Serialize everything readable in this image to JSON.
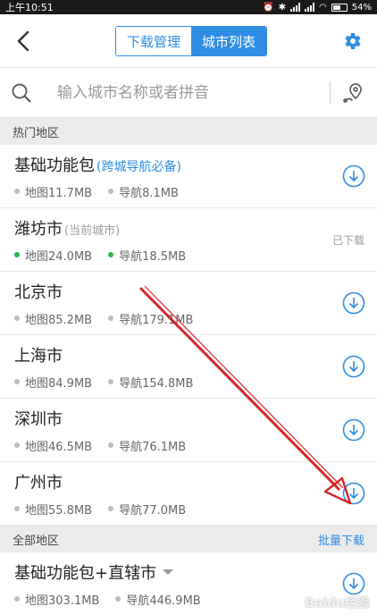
{
  "status_bar": {
    "time": "上午10:51",
    "battery": "54%"
  },
  "header": {
    "tabs": [
      "下载管理",
      "城市列表"
    ],
    "active_tab": 1
  },
  "search": {
    "placeholder": "输入城市名称或者拼音"
  },
  "hot_section": {
    "title": "热门地区"
  },
  "hot_cities": [
    {
      "name": "基础功能包",
      "note": "(跨城导航必备)",
      "map": "地图11.7MB",
      "nav": "导航8.1MB",
      "state": "download"
    },
    {
      "name": "潍坊市",
      "note": "(当前城市)",
      "map": "地图24.0MB",
      "nav": "导航18.5MB",
      "state": "downloaded",
      "state_label": "已下载"
    },
    {
      "name": "北京市",
      "note": "",
      "map": "地图85.2MB",
      "nav": "导航179.1MB",
      "state": "download"
    },
    {
      "name": "上海市",
      "note": "",
      "map": "地图84.9MB",
      "nav": "导航154.8MB",
      "state": "download"
    },
    {
      "name": "深圳市",
      "note": "",
      "map": "地图46.5MB",
      "nav": "导航76.1MB",
      "state": "download"
    },
    {
      "name": "广州市",
      "note": "",
      "map": "地图55.8MB",
      "nav": "导航77.0MB",
      "state": "download"
    }
  ],
  "all_section": {
    "title": "全部地区",
    "action": "批量下载"
  },
  "all_cities": [
    {
      "name": "基础功能包+直辖市",
      "map": "地图303.1MB",
      "nav": "导航446.9MB",
      "state": "download"
    }
  ],
  "watermark": "Baidu经验",
  "colors": {
    "accent": "#2f8de4",
    "downloaded_dot": "#2cb34a",
    "annotation_arrow": "#d9252a"
  }
}
